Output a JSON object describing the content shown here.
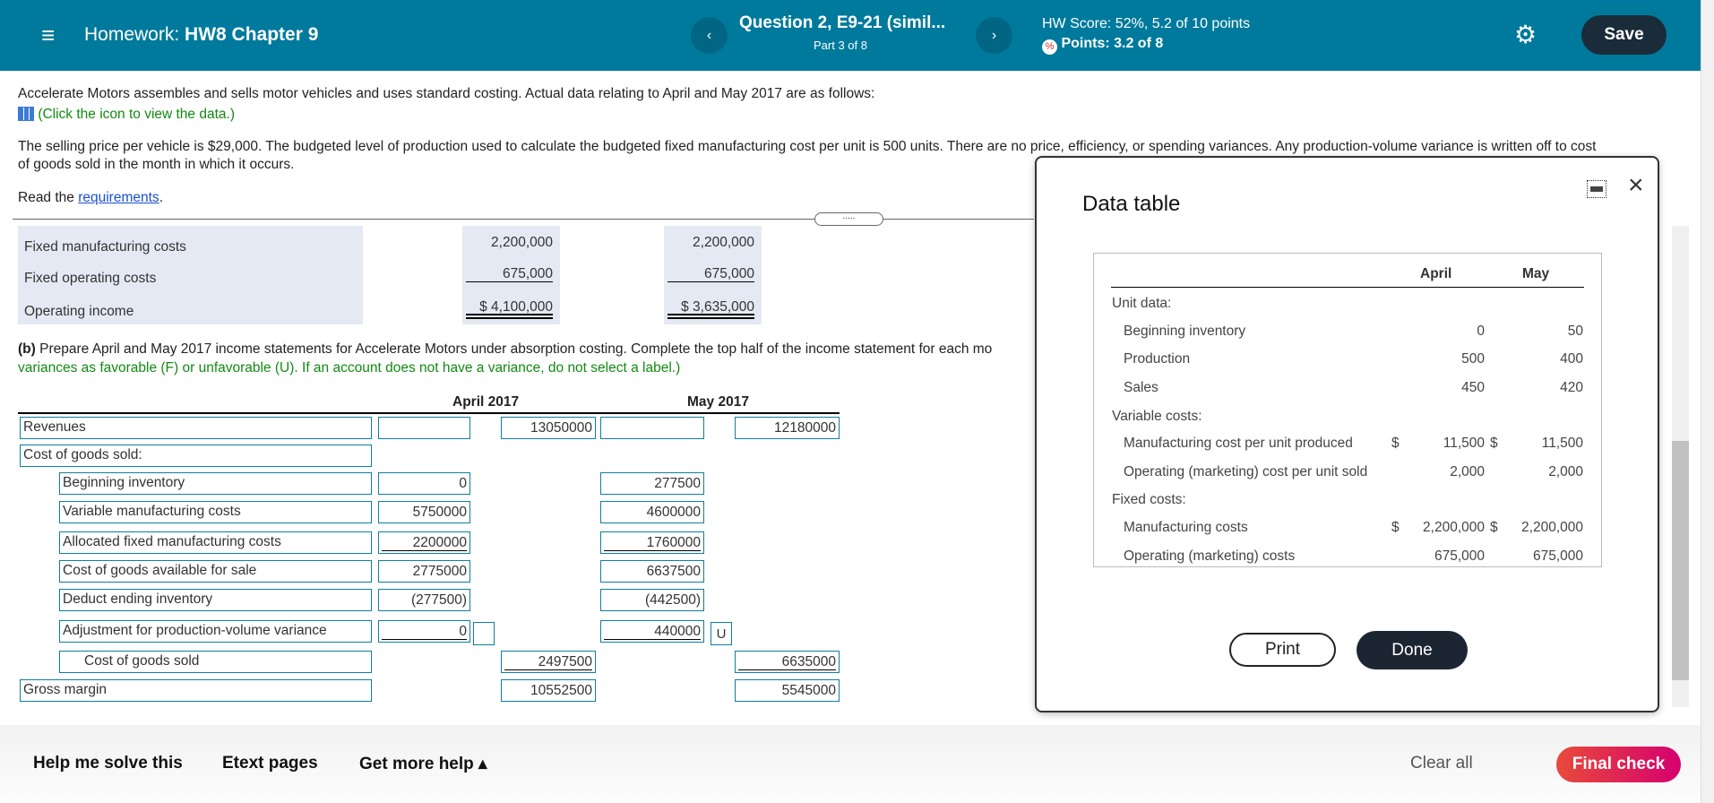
{
  "header": {
    "menu_icon": "hamburger-icon",
    "homework_prefix": "Homework:",
    "homework_title": "HW8 Chapter 9",
    "question_title": "Question 2, E9-21 (simil...",
    "question_part": "Part 3 of 8",
    "hw_score": "HW Score: 52%, 5.2 of 10 points",
    "points": "Points: 3.2 of 8",
    "save_label": "Save",
    "prev_label": "‹",
    "next_label": "›",
    "color": "#007a9c"
  },
  "problem": {
    "intro": "Accelerate Motors assembles and sells motor vehicles and uses standard costing. Actual data relating to April and May 2017 are as follows:",
    "data_link": "(Click the icon to view the data.)",
    "selling_line1": "The selling price per vehicle is $29,000. The budgeted level of production used to calculate the budgeted fixed manufacturing cost per unit is 500 units. There are no price, efficiency, or spending variances. Any production-volume variance is written off to cost",
    "selling_line2": "of goods sold in the month in which it occurs.",
    "read_prefix": "Read the ",
    "read_link": "requirements",
    "read_suffix": ".",
    "handle": "....."
  },
  "prior": {
    "rows": [
      {
        "label": "Fixed manufacturing costs",
        "april": "2,200,000",
        "may": "2,200,000"
      },
      {
        "label": "Fixed operating costs",
        "april": "675,000",
        "may": "675,000"
      },
      {
        "label": "Operating income",
        "april": "$  4,100,000",
        "may": "$  3,635,000"
      }
    ]
  },
  "part_b": {
    "bold": "(b)",
    "line1": " Prepare April and May 2017 income statements for Accelerate Motors under absorption costing. Complete the top half of the income statement for each mo",
    "line2": "variances as favorable (F) or unfavorable (U). If an account does not have a variance, do not select a label.)",
    "col_april": "April 2017",
    "col_may": "May 2017"
  },
  "income_statement": [
    {
      "label": "Revenues",
      "indent": 0,
      "april_inner": "",
      "april_outer": "13050000",
      "may_inner": "",
      "may_outer": "12180000"
    },
    {
      "label": "Cost of goods sold:",
      "indent": 0
    },
    {
      "label": "Beginning inventory",
      "indent": 1,
      "april_inner": "0",
      "may_inner": "277500"
    },
    {
      "label": "Variable manufacturing costs",
      "indent": 1,
      "april_inner": "5750000",
      "may_inner": "4600000"
    },
    {
      "label": "Allocated fixed manufacturing costs",
      "indent": 1,
      "april_inner": "2200000",
      "may_inner": "1760000",
      "underline": true
    },
    {
      "label": "Cost of goods available for sale",
      "indent": 1,
      "april_inner": "2775000",
      "may_inner": "6637500"
    },
    {
      "label": "Deduct ending inventory",
      "indent": 1,
      "april_inner": "(277500)",
      "may_inner": "(442500)"
    },
    {
      "label": "Adjustment for production-volume variance",
      "indent": 1,
      "april_inner": "0",
      "may_inner": "440000",
      "underline": true,
      "april_flag": "",
      "may_flag": "U"
    },
    {
      "label": "Cost of goods sold",
      "indent": 2,
      "april_outer": "2497500",
      "may_outer": "6635000",
      "underline": true
    },
    {
      "label": "Gross margin",
      "indent": 0,
      "april_outer": "10552500",
      "may_outer": "5545000"
    }
  ],
  "modal": {
    "title": "Data table",
    "minimize_icon": "minimize-icon",
    "close_icon": "close-icon",
    "col_april": "April",
    "col_may": "May",
    "rows": [
      {
        "label": "Unit data:",
        "section": true
      },
      {
        "label": "Beginning inventory",
        "april": "0",
        "may": "50"
      },
      {
        "label": "Production",
        "april": "500",
        "may": "400"
      },
      {
        "label": "Sales",
        "april": "450",
        "may": "420"
      },
      {
        "label": "Variable costs:",
        "section": true
      },
      {
        "label": "Manufacturing cost per unit produced",
        "april": "11,500",
        "may": "11,500",
        "dollar": "$"
      },
      {
        "label": "Operating (marketing) cost per unit sold",
        "april": "2,000",
        "may": "2,000"
      },
      {
        "label": "Fixed costs:",
        "section": true
      },
      {
        "label": "Manufacturing costs",
        "april": "2,200,000",
        "may": "2,200,000",
        "dollar": "$"
      },
      {
        "label": "Operating (marketing) costs",
        "april": "675,000",
        "may": "675,000"
      }
    ],
    "print_label": "Print",
    "done_label": "Done"
  },
  "footer": {
    "help": "Help me solve this",
    "etext": "Etext pages",
    "more_help": "Get more help ▴",
    "clear_all": "Clear all",
    "final_check": "Final check"
  }
}
